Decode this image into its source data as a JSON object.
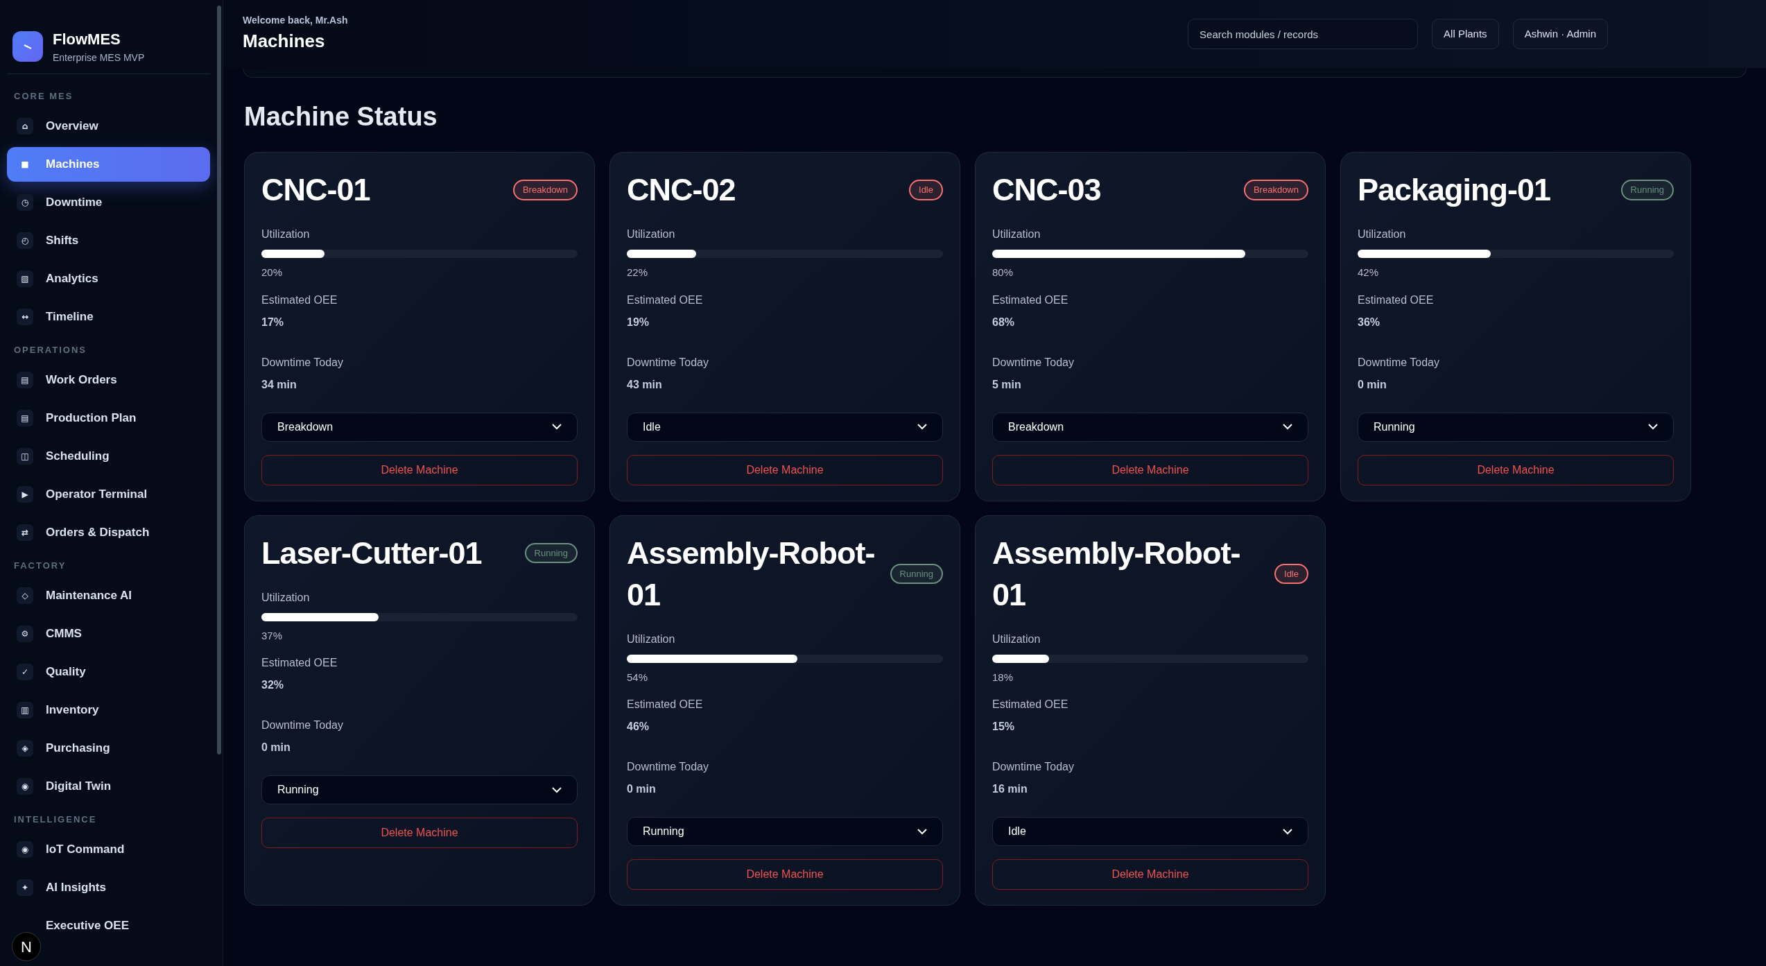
{
  "brand": {
    "name": "FlowMES",
    "subtitle": "Enterprise MES MVP"
  },
  "sidebar": {
    "sections": [
      {
        "title": "CORE MES",
        "items": [
          {
            "glyph": "⌂",
            "label": "Overview",
            "selected": false
          },
          {
            "glyph": "■",
            "label": "Machines",
            "selected": true
          },
          {
            "glyph": "◷",
            "label": "Downtime",
            "selected": false
          },
          {
            "glyph": "◴",
            "label": "Shifts",
            "selected": false
          },
          {
            "glyph": "▧",
            "label": "Analytics",
            "selected": false
          },
          {
            "glyph": "↔",
            "label": "Timeline",
            "selected": false
          }
        ]
      },
      {
        "title": "OPERATIONS",
        "items": [
          {
            "glyph": "▤",
            "label": "Work Orders",
            "selected": false
          },
          {
            "glyph": "▤",
            "label": "Production Plan",
            "selected": false
          },
          {
            "glyph": "◫",
            "label": "Scheduling",
            "selected": false
          },
          {
            "glyph": "▶",
            "label": "Operator Terminal",
            "selected": false
          },
          {
            "glyph": "⇄",
            "label": "Orders & Dispatch",
            "selected": false
          }
        ]
      },
      {
        "title": "FACTORY",
        "items": [
          {
            "glyph": "◇",
            "label": "Maintenance AI",
            "selected": false
          },
          {
            "glyph": "⚙",
            "label": "CMMS",
            "selected": false
          },
          {
            "glyph": "✓",
            "label": "Quality",
            "selected": false
          },
          {
            "glyph": "▥",
            "label": "Inventory",
            "selected": false
          },
          {
            "glyph": "◈",
            "label": "Purchasing",
            "selected": false
          },
          {
            "glyph": "◉",
            "label": "Digital Twin",
            "selected": false
          }
        ]
      },
      {
        "title": "INTELLIGENCE",
        "items": [
          {
            "glyph": "◉",
            "label": "IoT Command",
            "selected": false
          },
          {
            "glyph": "✦",
            "label": "AI Insights",
            "selected": false
          },
          {
            "label": "Executive OEE",
            "selected": false
          }
        ]
      }
    ]
  },
  "dev_badge": "N",
  "header": {
    "greeting": "Welcome back, Mr.Ash",
    "title": "Machines",
    "search": {
      "placeholder": "Search modules / records"
    },
    "buttons": [
      "All Plants",
      "Ashwin · Admin"
    ]
  },
  "section_title": "Machine Status",
  "machines": [
    {
      "name": "CNC-01",
      "badge": {
        "text": "Breakdown",
        "color": "#f87171"
      },
      "utilization_label": "Utilization",
      "level": 0.2,
      "utilization": "20%",
      "oee_label": "Estimated OEE",
      "oee": "17%",
      "downtime_label": "Downtime Today",
      "downtime": "34 min",
      "status_value": "Breakdown",
      "delete": "Delete Machine"
    },
    {
      "name": "CNC-02",
      "badge": {
        "text": "Idle",
        "color": "#f87171"
      },
      "utilization_label": "Utilization",
      "level": 0.22,
      "utilization": "22%",
      "oee_label": "Estimated OEE",
      "oee": "19%",
      "downtime_label": "Downtime Today",
      "downtime": "43 min",
      "status_value": "Idle",
      "delete": "Delete Machine"
    },
    {
      "name": "CNC-03",
      "badge": {
        "text": "Breakdown",
        "color": "#f87171"
      },
      "utilization_label": "Utilization",
      "level": 0.8,
      "utilization": "80%",
      "oee_label": "Estimated OEE",
      "oee": "68%",
      "downtime_label": "Downtime Today",
      "downtime": "5 min",
      "status_value": "Breakdown",
      "delete": "Delete Machine"
    },
    {
      "name": "Packaging-01",
      "badge": {
        "text": "Running",
        "color": "#6b8f80"
      },
      "utilization_label": "Utilization",
      "level": 0.42,
      "utilization": "42%",
      "oee_label": "Estimated OEE",
      "oee": "36%",
      "downtime_label": "Downtime Today",
      "downtime": "0 min",
      "status_value": "Running",
      "delete": "Delete Machine"
    },
    {
      "name": "Laser-Cutter-01",
      "badge": {
        "text": "Running",
        "color": "#6b8f80"
      },
      "utilization_label": "Utilization",
      "level": 0.37,
      "utilization": "37%",
      "oee_label": "Estimated OEE",
      "oee": "32%",
      "downtime_label": "Downtime Today",
      "downtime": "0 min",
      "status_value": "Running",
      "delete": "Delete Machine"
    },
    {
      "name": "Assembly-Robot-01",
      "badge": {
        "text": "Running",
        "color": "#6b8f80"
      },
      "utilization_label": "Utilization",
      "level": 0.54,
      "utilization": "54%",
      "oee_label": "Estimated OEE",
      "oee": "46%",
      "downtime_label": "Downtime Today",
      "downtime": "0 min",
      "status_value": "Running",
      "delete": "Delete Machine"
    },
    {
      "name": "Assembly-Robot-01",
      "badge": {
        "text": "Idle",
        "color": "#f87171"
      },
      "utilization_label": "Utilization",
      "level": 0.18,
      "utilization": "18%",
      "oee_label": "Estimated OEE",
      "oee": "15%",
      "downtime_label": "Downtime Today",
      "downtime": "16 min",
      "status_value": "Idle",
      "delete": "Delete Machine"
    }
  ]
}
